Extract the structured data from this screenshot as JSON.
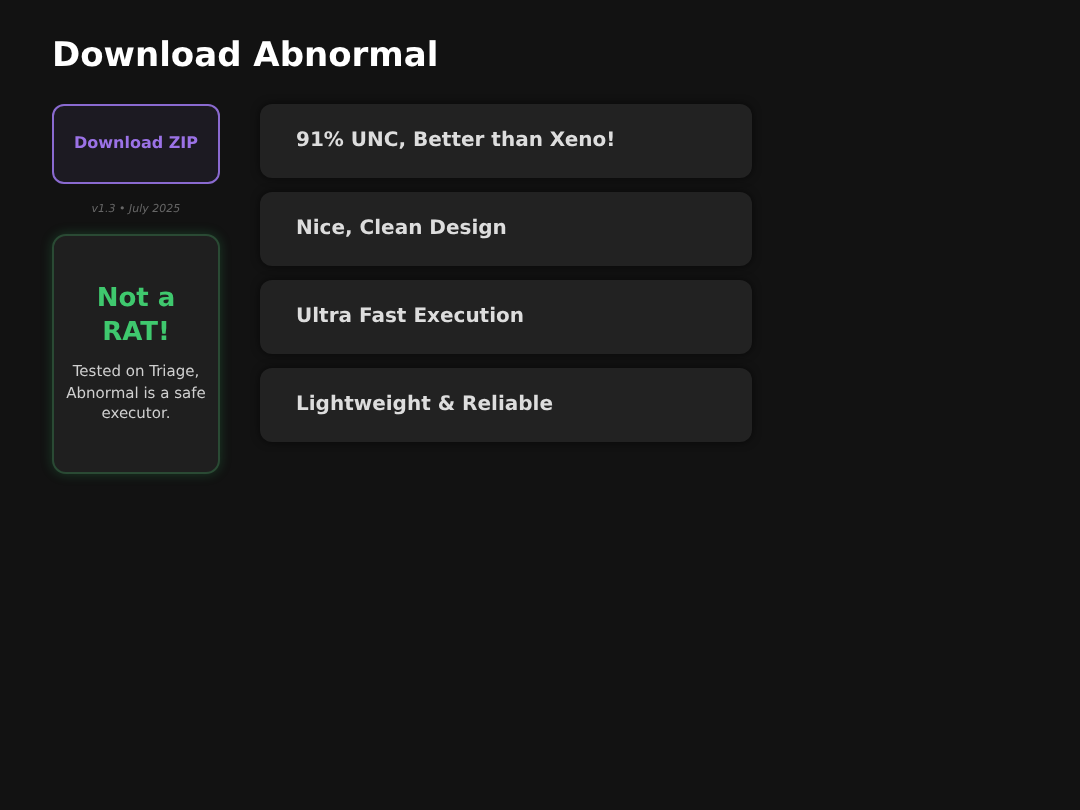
{
  "title": "Download Abnormal",
  "download_button": {
    "label": "Download ZIP"
  },
  "version": "v1.3 • July 2025",
  "safety_card": {
    "heading": "Not a RAT!",
    "text": "Tested on Triage, Abnormal is a safe executor."
  },
  "features": [
    {
      "label": "91% UNC, Better than Xeno!"
    },
    {
      "label": "Nice, Clean Design"
    },
    {
      "label": "Ultra Fast Execution"
    },
    {
      "label": "Lightweight & Reliable"
    }
  ]
}
